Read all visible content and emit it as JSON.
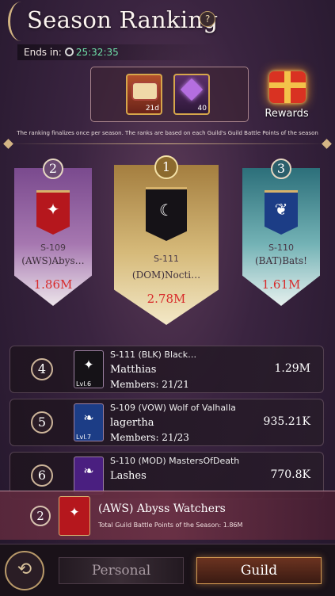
{
  "header": {
    "title": "Season Ranking",
    "help_label": "?",
    "ends_label": "Ends in:",
    "ends_time": "25:32:35"
  },
  "rewards": {
    "items": [
      {
        "icon": "scroll-icon",
        "count": "21d"
      },
      {
        "icon": "gem-icon",
        "count": "40"
      }
    ],
    "button_label": "Rewards"
  },
  "info_text": "The ranking finalizes once per season. The ranks are based on each Guild's Guild Battle Points of the season",
  "podium": [
    {
      "rank": "1",
      "server": "S-111",
      "name": "(DOM)Nocti…",
      "points": "2.78M"
    },
    {
      "rank": "2",
      "server": "S-109",
      "name": "(AWS)Abys…",
      "points": "1.86M"
    },
    {
      "rank": "3",
      "server": "S-110",
      "name": "(BAT)Bats!",
      "points": "1.61M"
    }
  ],
  "list": [
    {
      "rank": "4",
      "guild": "S-111 (BLK) Black…",
      "leader": "Matthias",
      "members": "Members:  21/21",
      "level": "Lvl.6",
      "points": "1.29M"
    },
    {
      "rank": "5",
      "guild": "S-109 (VOW) Wolf of Valhalla",
      "leader": "lagertha",
      "members": "Members:  21/23",
      "level": "Lvl.7",
      "points": "935.21K"
    },
    {
      "rank": "6",
      "guild": "S-110 (MOD) MastersOfDeath",
      "leader": "Lashes",
      "members": "",
      "level": "",
      "points": "770.8K"
    }
  ],
  "my_guild": {
    "rank": "2",
    "name": "(AWS) Abyss Watchers",
    "desc": "Total Guild Battle Points of the Season: 1.86M"
  },
  "nav": {
    "personal_label": "Personal",
    "guild_label": "Guild"
  },
  "colors": {
    "points_red": "#d82c2c",
    "timer_green": "#6fe0a8",
    "gold": "#d6a64b"
  }
}
